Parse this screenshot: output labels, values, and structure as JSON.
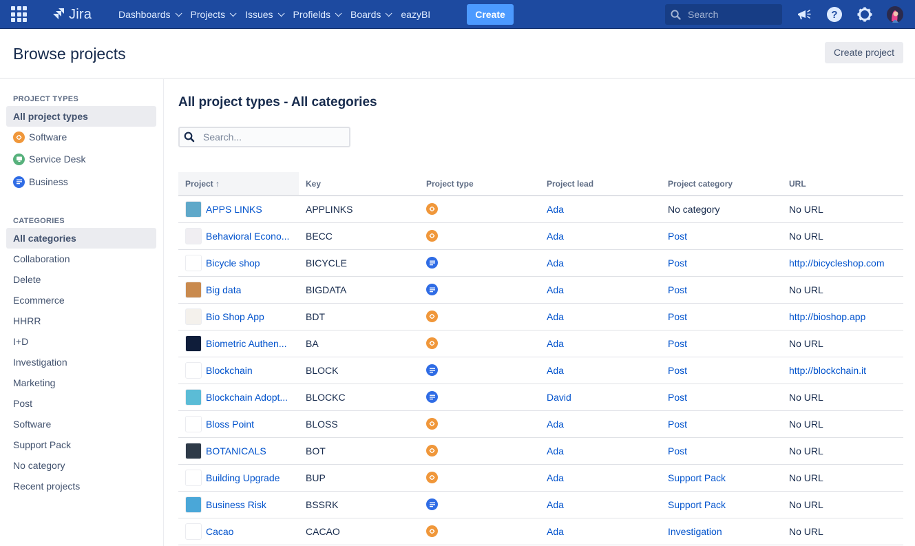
{
  "topnav": {
    "app_name": "Jira",
    "items": [
      {
        "label": "Dashboards",
        "dropdown": true
      },
      {
        "label": "Projects",
        "dropdown": true
      },
      {
        "label": "Issues",
        "dropdown": true
      },
      {
        "label": "Profields",
        "dropdown": true
      },
      {
        "label": "Boards",
        "dropdown": true
      },
      {
        "label": "eazyBI",
        "dropdown": false
      }
    ],
    "create_label": "Create",
    "search_placeholder": "Search",
    "icons": [
      "app-switcher-icon",
      "jira-logo-icon",
      "notifications-megaphone-icon",
      "help-icon",
      "settings-gear-icon",
      "user-avatar"
    ]
  },
  "header": {
    "title": "Browse projects",
    "create_project_label": "Create project"
  },
  "sidebar": {
    "project_types_heading": "PROJECT TYPES",
    "project_types": [
      {
        "label": "All project types",
        "active": true,
        "icon": ""
      },
      {
        "label": "Software",
        "active": false,
        "icon": "software"
      },
      {
        "label": "Service Desk",
        "active": false,
        "icon": "service"
      },
      {
        "label": "Business",
        "active": false,
        "icon": "business"
      }
    ],
    "categories_heading": "CATEGORIES",
    "categories": [
      {
        "label": "All categories",
        "active": true
      },
      {
        "label": "Collaboration",
        "active": false
      },
      {
        "label": "Delete",
        "active": false
      },
      {
        "label": "Ecommerce",
        "active": false
      },
      {
        "label": "HHRR",
        "active": false
      },
      {
        "label": "I+D",
        "active": false
      },
      {
        "label": "Investigation",
        "active": false
      },
      {
        "label": "Marketing",
        "active": false
      },
      {
        "label": "Post",
        "active": false
      },
      {
        "label": "Software",
        "active": false
      },
      {
        "label": "Support Pack",
        "active": false
      },
      {
        "label": "No category",
        "active": false
      },
      {
        "label": "Recent projects",
        "active": false
      }
    ]
  },
  "main": {
    "title": "All project types - All categories",
    "search_placeholder": "Search...",
    "search_value": "",
    "columns": [
      "Project",
      "Key",
      "Project type",
      "Project lead",
      "Project category",
      "URL"
    ],
    "sort_indicator": "↑",
    "rows": [
      {
        "name": "APPS LINKS",
        "key": "APPLINKS",
        "type": "software",
        "lead": "Ada",
        "category": "No category",
        "category_link": false,
        "url": "No URL",
        "url_link": false,
        "avatar_color": "#5fa8c9"
      },
      {
        "name": "Behavioral Econo...",
        "key": "BECC",
        "type": "software",
        "lead": "Ada",
        "category": "Post",
        "category_link": true,
        "url": "No URL",
        "url_link": false,
        "avatar_color": "#f0eef2"
      },
      {
        "name": "Bicycle shop",
        "key": "BICYCLE",
        "type": "business",
        "lead": "Ada",
        "category": "Post",
        "category_link": true,
        "url": "http://bicycleshop.com",
        "url_link": true,
        "avatar_color": "#ffffff"
      },
      {
        "name": "Big data",
        "key": "BIGDATA",
        "type": "business",
        "lead": "Ada",
        "category": "Post",
        "category_link": true,
        "url": "No URL",
        "url_link": false,
        "avatar_color": "#c98a4e"
      },
      {
        "name": "Bio Shop App",
        "key": "BDT",
        "type": "software",
        "lead": "Ada",
        "category": "Post",
        "category_link": true,
        "url": "http://bioshop.app",
        "url_link": true,
        "avatar_color": "#f4f1ec"
      },
      {
        "name": "Biometric Authen...",
        "key": "BA",
        "type": "software",
        "lead": "Ada",
        "category": "Post",
        "category_link": true,
        "url": "No URL",
        "url_link": false,
        "avatar_color": "#0f1d3a"
      },
      {
        "name": "Blockchain",
        "key": "BLOCK",
        "type": "business",
        "lead": "Ada",
        "category": "Post",
        "category_link": true,
        "url": "http://blockchain.it",
        "url_link": true,
        "avatar_color": "#ffffff"
      },
      {
        "name": "Blockchain Adopt...",
        "key": "BLOCKC",
        "type": "business",
        "lead": "David",
        "category": "Post",
        "category_link": true,
        "url": "No URL",
        "url_link": false,
        "avatar_color": "#5bbcd6"
      },
      {
        "name": "Bloss Point",
        "key": "BLOSS",
        "type": "software",
        "lead": "Ada",
        "category": "Post",
        "category_link": true,
        "url": "No URL",
        "url_link": false,
        "avatar_color": "#ffffff"
      },
      {
        "name": "BOTANICALS",
        "key": "BOT",
        "type": "software",
        "lead": "Ada",
        "category": "Post",
        "category_link": true,
        "url": "No URL",
        "url_link": false,
        "avatar_color": "#2e3a48"
      },
      {
        "name": "Building Upgrade",
        "key": "BUP",
        "type": "software",
        "lead": "Ada",
        "category": "Support Pack",
        "category_link": true,
        "url": "No URL",
        "url_link": false,
        "avatar_color": "#ffffff"
      },
      {
        "name": "Business Risk",
        "key": "BSSRK",
        "type": "business",
        "lead": "Ada",
        "category": "Support Pack",
        "category_link": true,
        "url": "No URL",
        "url_link": false,
        "avatar_color": "#4aa7d8"
      },
      {
        "name": "Cacao",
        "key": "CACAO",
        "type": "software",
        "lead": "Ada",
        "category": "Investigation",
        "category_link": true,
        "url": "No URL",
        "url_link": false,
        "avatar_color": "#ffffff"
      }
    ]
  },
  "colors": {
    "nav_bg": "#1d4aa0",
    "create_button": "#4c9aff",
    "link": "#0052cc",
    "software_type": "#f0973a",
    "service_desk_type": "#57b17c",
    "business_type": "#2f6ce5"
  }
}
